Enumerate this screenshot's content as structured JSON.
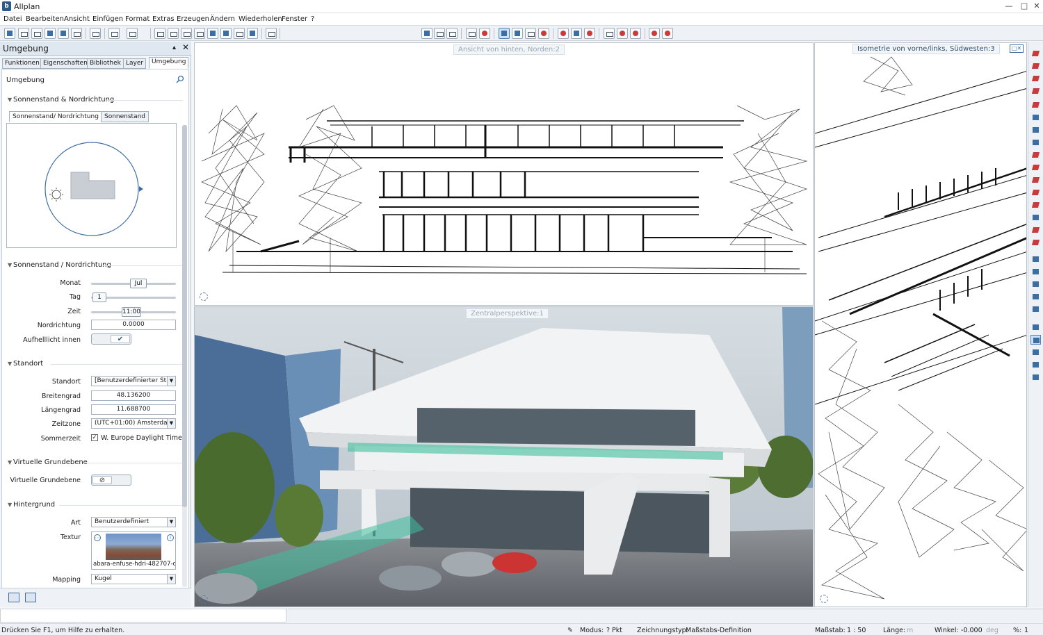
{
  "window": {
    "title": "Allplan",
    "logo": "b"
  },
  "menu": [
    "Datei",
    "Bearbeiten",
    "Ansicht",
    "Einfügen",
    "Format",
    "Extras",
    "Erzeugen",
    "Ändern",
    "Wiederholen",
    "Fenster",
    "?"
  ],
  "palette": {
    "title": "Umgebung",
    "tabs": [
      "Funktionen",
      "Eigenschaften",
      "Bibliothek",
      "Layer",
      "Umgebung"
    ],
    "search_label": "Umgebung",
    "section_sun_north": "Sonnenstand & Nordrichtung",
    "subtabs": [
      "Sonnenstand/ Nordrichtung",
      "Sonnenstand"
    ],
    "section_sun_north2": "Sonnenstand / Nordrichtung",
    "monat_label": "Monat",
    "monat_value": "Jul",
    "tag_label": "Tag",
    "tag_value": "1",
    "zeit_label": "Zeit",
    "zeit_value": "11:00",
    "nord_label": "Nordrichtung",
    "nord_value": "0.0000",
    "aufhell_label": "Aufhelllicht innen",
    "section_standort": "Standort",
    "standort_label": "Standort",
    "standort_value": "[Benutzerdefinierter Sta",
    "breite_label": "Breitengrad",
    "breite_value": "48.136200",
    "laenge_label": "Längengrad",
    "laenge_value": "11.688700",
    "zone_label": "Zeitzone",
    "zone_value": "(UTC+01:00) Amsterdan",
    "sommer_label": "Sommerzeit",
    "sommer_value": "W. Europe Daylight Time",
    "section_virtual": "Virtuelle Grundebene",
    "virtual_label": "Virtuelle Grundebene",
    "section_hintergrund": "Hintergrund",
    "art_label": "Art",
    "art_value": "Benutzerdefiniert",
    "textur_label": "Textur",
    "textur_value": "abara-enfuse-hdri-482707-c",
    "mapping_label": "Mapping",
    "mapping_value": "Kugel"
  },
  "viewports": {
    "top_left": "Ansicht von hinten, Norden:2",
    "bottom_left": "Zentralperspektive:1",
    "right": "Isometrie von vorne/links, Südwesten:3"
  },
  "status": {
    "hint": "Drücken Sie F1, um Hilfe zu erhalten.",
    "modus_label": "Modus:",
    "modus_value": "? Pkt",
    "ztyp_label": "Zeichnungstyp:",
    "ztyp_value": "Maßstabs-Definition",
    "massstab_label": "Maßstab:",
    "massstab_value": "1 : 50",
    "laenge_label": "Länge:",
    "laenge_unit": "m",
    "winkel_label": "Winkel:",
    "winkel_value": "-0.000",
    "winkel_unit": "deg",
    "pct_label": "%:",
    "pct_value": "1"
  },
  "colors": {
    "accent": "#3d6ea3",
    "danger": "#c93a3a",
    "glass": "#3fbf9f"
  }
}
